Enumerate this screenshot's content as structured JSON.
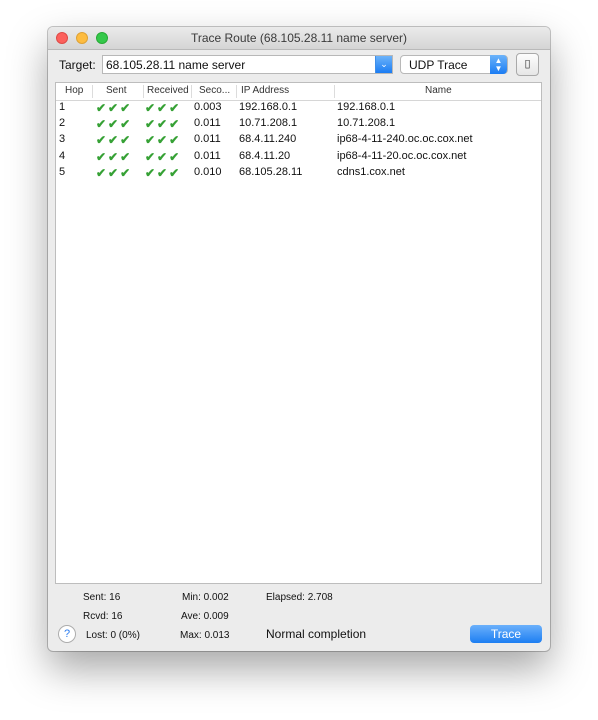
{
  "window": {
    "title": "Trace Route (68.105.28.11 name server)"
  },
  "toolbar": {
    "target_label": "Target:",
    "target_value": "68.105.28.11 name server",
    "trace_type": "UDP Trace"
  },
  "table": {
    "headers": {
      "hop": "Hop",
      "sent": "Sent",
      "received": "Received",
      "seconds": "Seco...",
      "ip": "IP Address",
      "name": "Name"
    },
    "rows": [
      {
        "hop": "1",
        "sent": "✔✔✔",
        "received": "✔✔✔",
        "seconds": "0.003",
        "ip": "192.168.0.1",
        "name": "192.168.0.1"
      },
      {
        "hop": "2",
        "sent": "✔✔✔",
        "received": "✔✔✔",
        "seconds": "0.011",
        "ip": "10.71.208.1",
        "name": "10.71.208.1"
      },
      {
        "hop": "3",
        "sent": "✔✔✔",
        "received": "✔✔✔",
        "seconds": "0.011",
        "ip": "68.4.11.240",
        "name": "ip68-4-11-240.oc.oc.cox.net"
      },
      {
        "hop": "4",
        "sent": "✔✔✔",
        "received": "✔✔✔",
        "seconds": "0.011",
        "ip": "68.4.11.20",
        "name": "ip68-4-11-20.oc.oc.cox.net"
      },
      {
        "hop": "5",
        "sent": "✔✔✔",
        "received": "✔✔✔",
        "seconds": "0.010",
        "ip": "68.105.28.11",
        "name": "cdns1.cox.net"
      }
    ]
  },
  "stats": {
    "sent": "Sent:  16",
    "rcvd": "Rcvd:  16",
    "lost": "Lost:  0 (0%)",
    "min": "Min:  0.002",
    "ave": "Ave:  0.009",
    "max": "Max:  0.013",
    "elapsed": "Elapsed:  2.708"
  },
  "status": "Normal completion",
  "buttons": {
    "help": "?",
    "trace": "Trace"
  },
  "icons": {
    "close": "close-icon",
    "minimize": "minimize-icon",
    "zoom": "zoom-icon",
    "dropdown": "chevron-down-icon",
    "stepper": "up-down-chevron-icon",
    "copy": "copy-icon",
    "check": "checkmark-icon"
  }
}
